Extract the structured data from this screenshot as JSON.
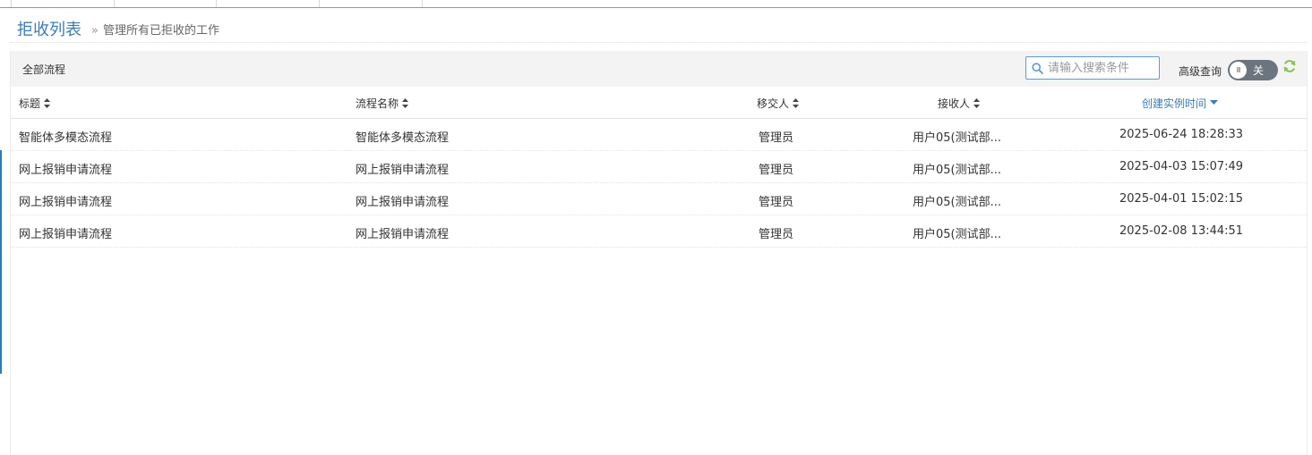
{
  "header": {
    "title": "拒收列表",
    "separator": "»",
    "subtitle": "管理所有已拒收的工作"
  },
  "toolbar": {
    "title": "全部流程",
    "search_placeholder": "请输入搜索条件",
    "advanced_label": "高级查询",
    "toggle_text": "关",
    "toggle_knob": "III"
  },
  "table": {
    "columns": [
      "标题",
      "流程名称",
      "移交人",
      "接收人",
      "创建实例时间"
    ],
    "active_sort_column": "创建实例时间",
    "rows": [
      {
        "title": "智能体多模态流程",
        "process": "智能体多模态流程",
        "from": "管理员",
        "to": "用户05(测试部...",
        "time": "2025-06-24 18:28:33"
      },
      {
        "title": "网上报销申请流程",
        "process": "网上报销申请流程",
        "from": "管理员",
        "to": "用户05(测试部...",
        "time": "2025-04-03 15:07:49"
      },
      {
        "title": "网上报销申请流程",
        "process": "网上报销申请流程",
        "from": "管理员",
        "to": "用户05(测试部...",
        "time": "2025-04-01 15:02:15"
      },
      {
        "title": "网上报销申请流程",
        "process": "网上报销申请流程",
        "from": "管理员",
        "to": "用户05(测试部...",
        "time": "2025-02-08 13:44:51"
      }
    ]
  },
  "colors": {
    "accent": "#3c7cb6",
    "toggle_off": "#6c757d",
    "refresh": "#8cc152"
  }
}
